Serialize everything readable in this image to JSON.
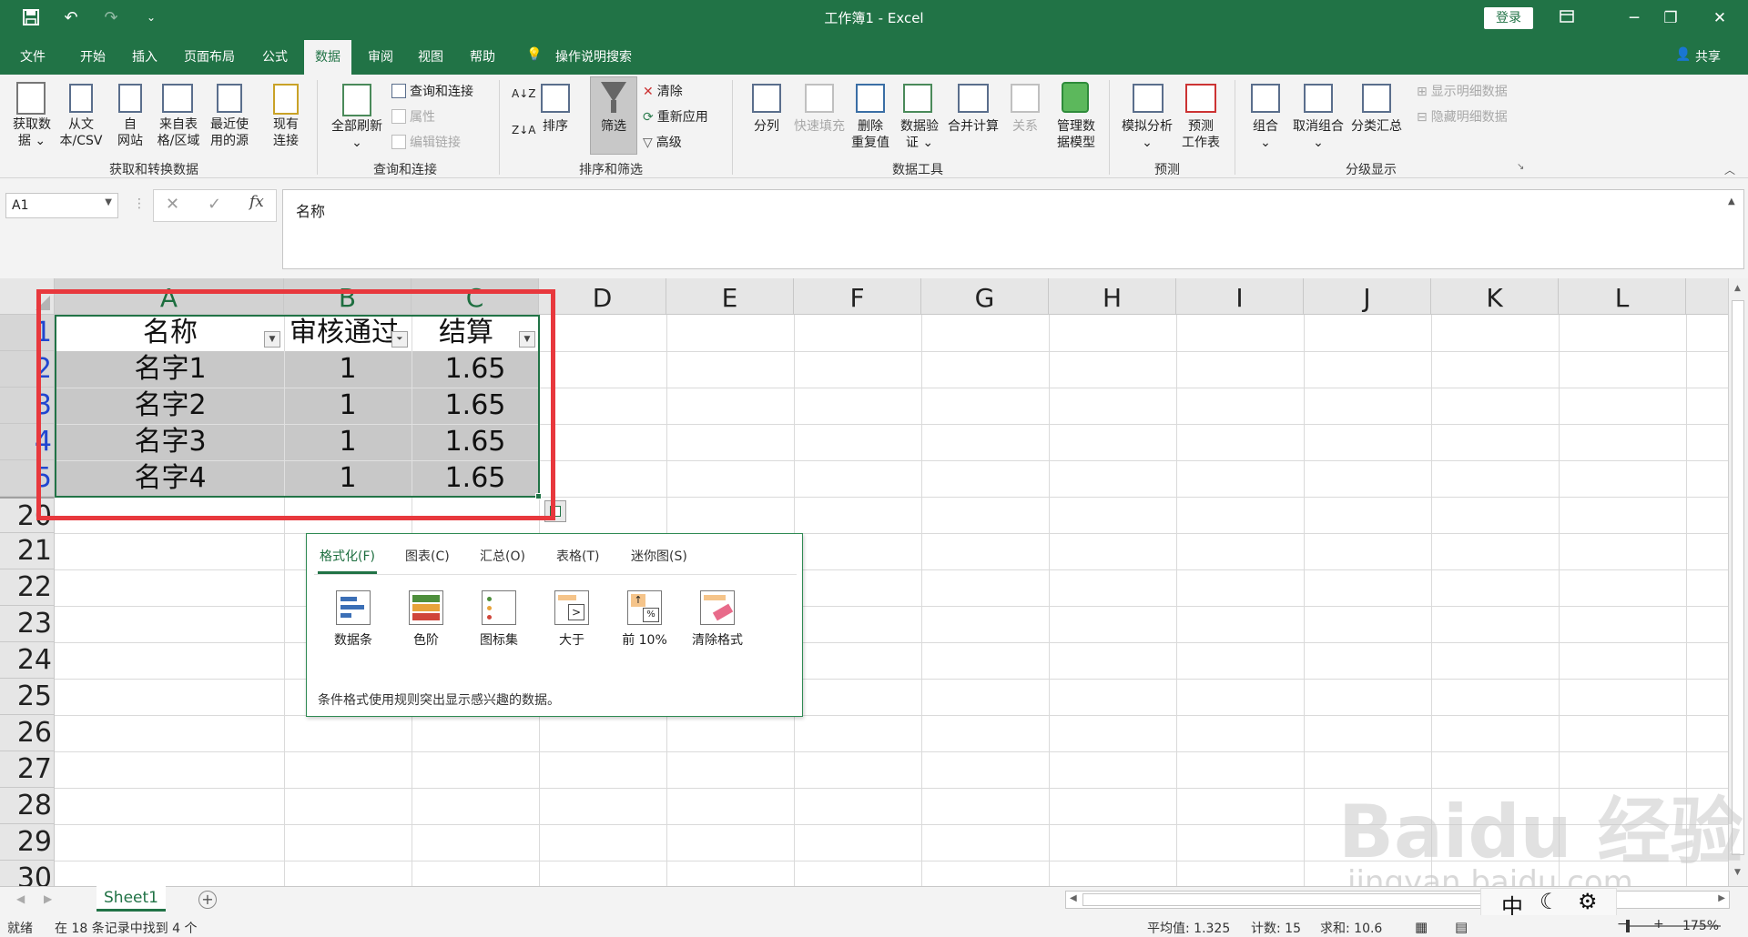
{
  "titlebar": {
    "title": "工作簿1  -  Excel",
    "login": "登录",
    "minimize": "─",
    "restore": "❐",
    "close": "✕"
  },
  "menu": {
    "tabs": [
      "文件",
      "开始",
      "插入",
      "页面布局",
      "公式",
      "数据",
      "审阅",
      "视图",
      "帮助"
    ],
    "active": "数据",
    "search": "操作说明搜索",
    "share": "共享"
  },
  "ribbon": {
    "get_data": "获取数\n据 ⌄",
    "from_csv": "从文\n本/CSV",
    "from_web": "自\n网站",
    "from_table": "来自表\n格/区域",
    "recent_sources": "最近使\n用的源",
    "existing_conn": "现有\n连接",
    "group1": "获取和转换数据",
    "refresh_all": "全部刷新\n⌄",
    "queries_conn": "查询和连接",
    "properties": "属性",
    "edit_links": "编辑链接",
    "group2": "查询和连接",
    "sort": "排序",
    "filter": "筛选",
    "clear": "清除",
    "reapply": "重新应用",
    "advanced": "高级",
    "group3": "排序和筛选",
    "text_to_columns": "分列",
    "flash_fill": "快速填充",
    "remove_dup": "删除\n重复值",
    "validation": "数据验\n证 ⌄",
    "consolidate": "合并计算",
    "relations": "关系",
    "data_model": "管理数\n据模型",
    "group4": "数据工具",
    "what_if": "模拟分析\n⌄",
    "forecast_sheet": "预测\n工作表",
    "group5": "预测",
    "group_btn": "组合\n⌄",
    "ungroup": "取消组合\n⌄",
    "subtotal": "分类汇总",
    "show_detail": "显示明细数据",
    "hide_detail": "隐藏明细数据",
    "group6": "分级显示"
  },
  "formula_bar": {
    "name_box": "A1",
    "cancel": "✕",
    "enter": "✓",
    "fx": "fx",
    "content": "名称"
  },
  "columns": [
    "A",
    "B",
    "C",
    "D",
    "E",
    "F",
    "G",
    "H",
    "I",
    "J",
    "K",
    "L"
  ],
  "rows": [
    "1",
    "2",
    "3",
    "4",
    "5",
    "20",
    "21",
    "22",
    "23",
    "24",
    "25",
    "26",
    "27",
    "28",
    "29",
    "30"
  ],
  "table": {
    "headers": [
      "名称",
      "审核通过",
      "结算"
    ],
    "body": [
      [
        "名字1",
        "1",
        "1.65"
      ],
      [
        "名字2",
        "1",
        "1.65"
      ],
      [
        "名字3",
        "1",
        "1.65"
      ],
      [
        "名字4",
        "1",
        "1.65"
      ]
    ]
  },
  "quick_analysis": {
    "tabs": [
      "格式化(F)",
      "图表(C)",
      "汇总(O)",
      "表格(T)",
      "迷你图(S)"
    ],
    "active_tab": "格式化(F)",
    "items": [
      "数据条",
      "色阶",
      "图标集",
      "大于",
      "前 10%",
      "清除格式"
    ],
    "description": "条件格式使用规则突出显示感兴趣的数据。"
  },
  "sheets": {
    "tabs": [
      "Sheet1"
    ],
    "add": "+"
  },
  "status": {
    "mode": "就绪",
    "filter_info": "在 18 条记录中找到 4 个",
    "average": "平均值: 1.325",
    "count": "计数: 15",
    "sum": "求和: 10.6",
    "zoom": "175%"
  },
  "ime": {
    "lang": "中",
    "moon": "☾",
    "gear": "⚙"
  },
  "watermark": {
    "text1": "Baidu 经验",
    "text2": "jingyan.baidu.com"
  },
  "colors": {
    "excel_green": "#217346",
    "highlight_red": "#e8383d",
    "selection_gray": "#c8c8c8"
  }
}
